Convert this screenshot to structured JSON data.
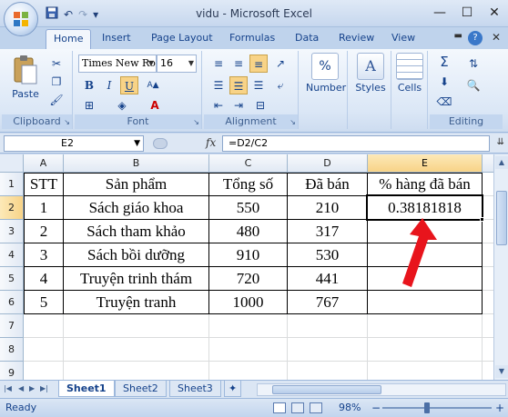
{
  "window": {
    "title": "vidu - Microsoft Excel",
    "minimize": "—",
    "maximize": "☐",
    "close": "✕"
  },
  "qat": {
    "save": "💾",
    "undo": "↶",
    "redo": "↷",
    "customize": "▾"
  },
  "tabs": [
    "Home",
    "Insert",
    "Page Layout",
    "Formulas",
    "Data",
    "Review",
    "View"
  ],
  "active_tab": "Home",
  "ribbon": {
    "clipboard": {
      "label": "Clipboard",
      "paste": "Paste"
    },
    "font": {
      "label": "Font",
      "family": "Times New Ro",
      "size": "16",
      "bold": "B",
      "italic": "I",
      "underline": "U",
      "color_a": "A"
    },
    "alignment": {
      "label": "Alignment"
    },
    "number": {
      "label": "Number",
      "icon_text": "%"
    },
    "styles": {
      "label": "Styles"
    },
    "cells": {
      "label": "Cells"
    },
    "editing": {
      "label": "Editing",
      "sum": "Σ"
    }
  },
  "formula_bar": {
    "name_box": "E2",
    "fx": "fx",
    "formula": "=D2/C2"
  },
  "columns": [
    "A",
    "B",
    "C",
    "D",
    "E"
  ],
  "active_column": "E",
  "rows": [
    "1",
    "2",
    "3",
    "4",
    "5",
    "6",
    "7",
    "8",
    "9"
  ],
  "active_row": "2",
  "table": {
    "headers": [
      "STT",
      "Sản phẩm",
      "Tổng số",
      "Đã bán",
      "% hàng đã bán"
    ],
    "rows": [
      [
        "1",
        "Sách giáo khoa",
        "550",
        "210",
        "0.38181818"
      ],
      [
        "2",
        "Sách tham khảo",
        "480",
        "317",
        ""
      ],
      [
        "3",
        "Sách bồi dưỡng",
        "910",
        "530",
        ""
      ],
      [
        "4",
        "Truyện trinh thám",
        "720",
        "441",
        ""
      ],
      [
        "5",
        "Truyện tranh",
        "1000",
        "767",
        ""
      ]
    ]
  },
  "sheets": [
    "Sheet1",
    "Sheet2",
    "Sheet3"
  ],
  "active_sheet": "Sheet1",
  "status": {
    "text": "Ready",
    "zoom": "98%",
    "minus": "−",
    "plus": "+"
  },
  "colors": {
    "arrow": "#e8141c",
    "ribbon_text": "#15428b"
  }
}
